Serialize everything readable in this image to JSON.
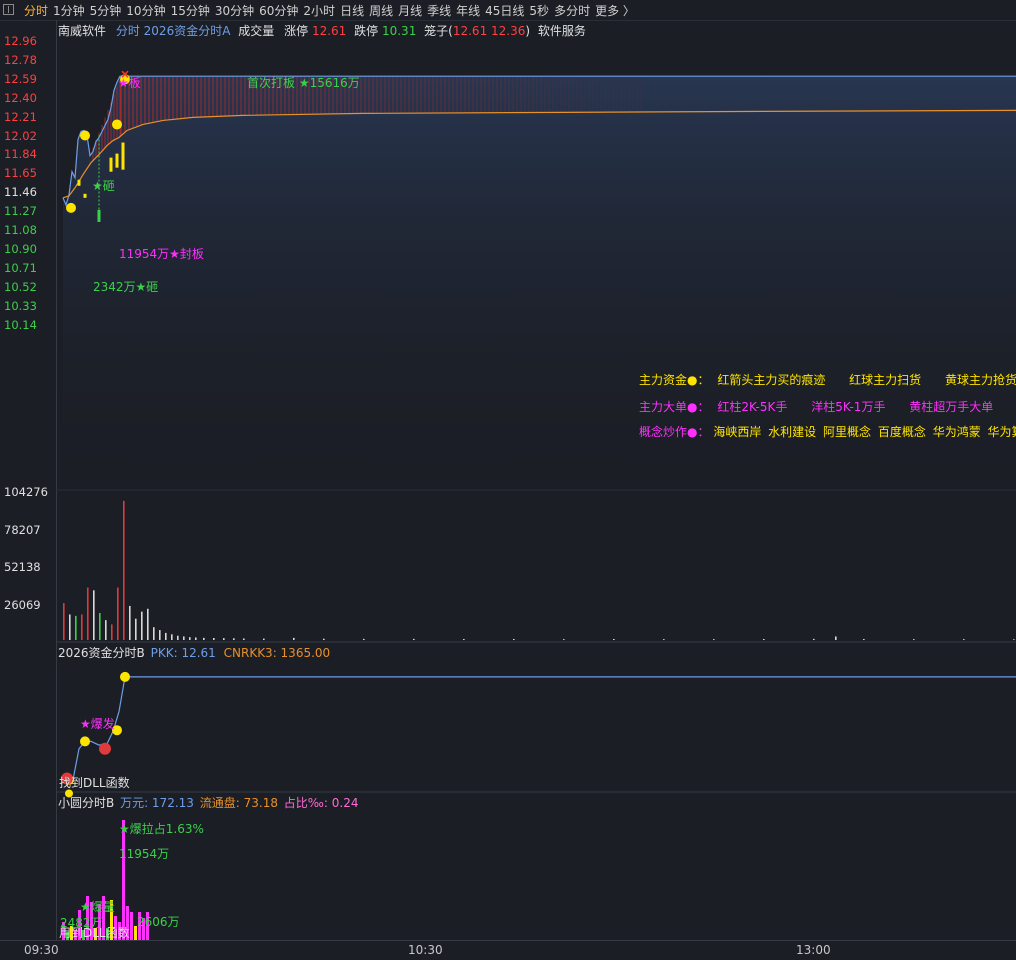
{
  "toolbar": {
    "items": [
      "分时",
      "1分钟",
      "5分钟",
      "10分钟",
      "15分钟",
      "30分钟",
      "60分钟",
      "2小时",
      "日线",
      "周线",
      "月线",
      "季线",
      "年线",
      "45日线",
      "5秒",
      "多分时",
      "更多 〉"
    ],
    "active_index": 0
  },
  "header": {
    "stock": "南威软件",
    "indicator": "分时 2026资金分时A",
    "volume_label": "成交量",
    "limit_up_label": "涨停",
    "limit_up": "12.61",
    "limit_down_label": "跌停",
    "limit_down": "10.31",
    "cage_label": "笼子(",
    "cage_values": "12.61 12.36",
    "cage_close": ")",
    "sector": "软件服务"
  },
  "price_axis": [
    {
      "v": "12.96",
      "c": "#ff4040"
    },
    {
      "v": "12.78",
      "c": "#ff4040"
    },
    {
      "v": "12.59",
      "c": "#ff4040"
    },
    {
      "v": "12.40",
      "c": "#ff4040"
    },
    {
      "v": "12.21",
      "c": "#ff4040"
    },
    {
      "v": "12.02",
      "c": "#ff4040"
    },
    {
      "v": "11.84",
      "c": "#ff4040"
    },
    {
      "v": "11.65",
      "c": "#ff4040"
    },
    {
      "v": "11.46",
      "c": "#e0e0e0"
    },
    {
      "v": "11.27",
      "c": "#3cd04a"
    },
    {
      "v": "11.08",
      "c": "#3cd04a"
    },
    {
      "v": "10.90",
      "c": "#3cd04a"
    },
    {
      "v": "10.71",
      "c": "#3cd04a"
    },
    {
      "v": "10.52",
      "c": "#3cd04a"
    },
    {
      "v": "10.33",
      "c": "#3cd04a"
    },
    {
      "v": "10.14",
      "c": "#3cd04a"
    }
  ],
  "volume_axis": [
    "104276",
    "78207",
    "52138",
    "26069"
  ],
  "annotations": {
    "board_star": "★板",
    "first_board": "首次打板 ★15616万",
    "smash_star": "★砸",
    "seal_board": "11954万★封板",
    "smash_amount": "2342万★砸"
  },
  "legend_main": {
    "row1": {
      "title": "主力资金●：",
      "items": [
        "红箭头主力买的痕迹",
        "红球主力扫货",
        "黄球主力抢货"
      ]
    },
    "row2": {
      "title": "主力大单●：",
      "items": [
        "红柱2K-5K手",
        "洋柱5K-1万手",
        "黄柱超万手大单"
      ]
    },
    "row3": {
      "title": "概念炒作●：",
      "items": [
        "海峡西岸",
        "水利建设",
        "阿里概念",
        "百度概念",
        "华为鸿蒙",
        "华为算力"
      ]
    }
  },
  "panel_b": {
    "title": "2026资金分时B",
    "pkk_label": "PKK: 12.61",
    "cnrkk_label": "CNRKK3: 1365.00",
    "burst": "★爆发",
    "dll_msg": "找到DLL函数"
  },
  "panel_c": {
    "title": "小圆分时B",
    "wan_label": "万元: 172.13",
    "float_label": "流通盘: 73.18",
    "ratio_label": "占比‰: 0.24",
    "burst_pull": "★爆拉占1.63%",
    "amount1": "11954万",
    "burst_vol": "★爆量",
    "amount2": "2482万",
    "amount3": "2606万",
    "overlap_text": "用到DLL函数"
  },
  "time_axis": [
    "09:30",
    "10:30",
    "13:00"
  ],
  "colors": {
    "red": "#ff4040",
    "green": "#3cd04a",
    "yellow": "#ffe400",
    "magenta": "#ff30ff",
    "blue_line": "#6e9ee8",
    "orange_line": "#e8902a"
  },
  "chart_data": {
    "type": "line",
    "price_series": [
      [
        0,
        11.4
      ],
      [
        3,
        11.33
      ],
      [
        6,
        11.43
      ],
      [
        9,
        11.66
      ],
      [
        12,
        11.6
      ],
      [
        15,
        11.98
      ],
      [
        18,
        12.06
      ],
      [
        21,
        12.07
      ],
      [
        24,
        12.02
      ],
      [
        27,
        11.82
      ],
      [
        30,
        11.86
      ],
      [
        33,
        11.96
      ],
      [
        36,
        12.0
      ],
      [
        39,
        12.06
      ],
      [
        42,
        12.12
      ],
      [
        45,
        12.18
      ],
      [
        48,
        12.3
      ],
      [
        51,
        12.47
      ],
      [
        54,
        12.55
      ],
      [
        57,
        12.61
      ],
      [
        960,
        12.61
      ]
    ],
    "avg_series": [
      [
        0,
        11.4
      ],
      [
        6,
        11.42
      ],
      [
        12,
        11.5
      ],
      [
        20,
        11.63
      ],
      [
        28,
        11.75
      ],
      [
        36,
        11.83
      ],
      [
        44,
        11.92
      ],
      [
        50,
        11.97
      ],
      [
        56,
        12.0
      ],
      [
        64,
        12.07
      ],
      [
        80,
        12.13
      ],
      [
        100,
        12.17
      ],
      [
        130,
        12.2
      ],
      [
        180,
        12.22
      ],
      [
        300,
        12.24
      ],
      [
        500,
        12.25
      ],
      [
        700,
        12.26
      ],
      [
        960,
        12.27
      ]
    ],
    "price_range": [
      10.14,
      12.96
    ],
    "volume_max": 104276,
    "volume_bars": [
      [
        0,
        26000,
        "r"
      ],
      [
        6,
        18000,
        "w"
      ],
      [
        12,
        17000,
        "g"
      ],
      [
        18,
        18000,
        "r"
      ],
      [
        24,
        37000,
        "r"
      ],
      [
        30,
        35000,
        "w"
      ],
      [
        36,
        19000,
        "g"
      ],
      [
        42,
        14000,
        "w"
      ],
      [
        48,
        11000,
        "r"
      ],
      [
        54,
        37000,
        "r"
      ],
      [
        60,
        98000,
        "r"
      ],
      [
        66,
        24000,
        "w"
      ],
      [
        72,
        15000,
        "w"
      ],
      [
        78,
        20000,
        "w"
      ],
      [
        84,
        22000,
        "w"
      ],
      [
        90,
        9000,
        "w"
      ],
      [
        96,
        7000,
        "w"
      ],
      [
        102,
        5000,
        "w"
      ],
      [
        108,
        4000,
        "w"
      ],
      [
        114,
        3000,
        "w"
      ],
      [
        120,
        2500,
        "w"
      ],
      [
        126,
        2000,
        "w"
      ],
      [
        132,
        1800,
        "w"
      ],
      [
        140,
        1500,
        "w"
      ],
      [
        150,
        1400,
        "w"
      ],
      [
        160,
        1300,
        "w"
      ],
      [
        170,
        1200,
        "w"
      ],
      [
        180,
        1100,
        "w"
      ],
      [
        200,
        1000,
        "w"
      ],
      [
        230,
        1500,
        "w"
      ],
      [
        260,
        900,
        "w"
      ],
      [
        300,
        800,
        "w"
      ],
      [
        350,
        800,
        "w"
      ],
      [
        400,
        700,
        "w"
      ],
      [
        450,
        700,
        "w"
      ],
      [
        500,
        600,
        "w"
      ],
      [
        550,
        700,
        "w"
      ],
      [
        600,
        600,
        "w"
      ],
      [
        650,
        600,
        "w"
      ],
      [
        700,
        700,
        "w"
      ],
      [
        750,
        800,
        "w"
      ],
      [
        772,
        2500,
        "w"
      ],
      [
        800,
        700,
        "w"
      ],
      [
        850,
        600,
        "w"
      ],
      [
        900,
        600,
        "w"
      ],
      [
        950,
        500,
        "w"
      ]
    ],
    "big_order_bars": [
      [
        16,
        11.58,
        11.52,
        "yellow"
      ],
      [
        22,
        11.44,
        11.4,
        "yellow"
      ],
      [
        36,
        11.28,
        11.16,
        "green"
      ],
      [
        48,
        11.8,
        11.66,
        "yellow"
      ],
      [
        54,
        11.84,
        11.7,
        "yellow"
      ],
      [
        60,
        11.95,
        11.68,
        "yellow"
      ]
    ],
    "money_dots": [
      [
        8,
        11.3
      ],
      [
        22,
        12.02
      ],
      [
        54,
        12.13
      ],
      [
        62,
        12.58
      ]
    ],
    "panel_b_series": [
      [
        0,
        0.04
      ],
      [
        10,
        0.05
      ],
      [
        16,
        0.3
      ],
      [
        22,
        0.36
      ],
      [
        28,
        0.36
      ],
      [
        36,
        0.33
      ],
      [
        44,
        0.34
      ],
      [
        50,
        0.44
      ],
      [
        56,
        0.6
      ],
      [
        62,
        0.88
      ],
      [
        960,
        0.88
      ]
    ],
    "panel_b_dots": [
      [
        6,
        0.05
      ],
      [
        22,
        0.36
      ],
      [
        54,
        0.45
      ],
      [
        62,
        0.88
      ]
    ],
    "panel_c_bars": [
      [
        0,
        18,
        "m"
      ],
      [
        4,
        8,
        "g"
      ],
      [
        8,
        14,
        "y"
      ],
      [
        12,
        10,
        "m"
      ],
      [
        16,
        30,
        "m"
      ],
      [
        20,
        10,
        "g"
      ],
      [
        24,
        44,
        "m"
      ],
      [
        28,
        38,
        "m"
      ],
      [
        32,
        12,
        "y"
      ],
      [
        36,
        36,
        "m"
      ],
      [
        40,
        44,
        "m"
      ],
      [
        44,
        12,
        "g"
      ],
      [
        48,
        40,
        "y"
      ],
      [
        52,
        24,
        "m"
      ],
      [
        56,
        18,
        "m"
      ],
      [
        60,
        120,
        "m"
      ],
      [
        64,
        34,
        "m"
      ],
      [
        68,
        28,
        "m"
      ],
      [
        72,
        14,
        "y"
      ],
      [
        76,
        28,
        "m"
      ],
      [
        80,
        22,
        "m"
      ],
      [
        84,
        28,
        "m"
      ]
    ]
  }
}
